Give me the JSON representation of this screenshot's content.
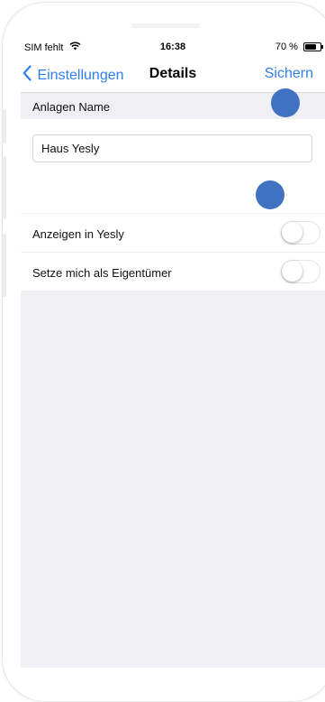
{
  "status_bar": {
    "carrier": "SIM fehlt",
    "time": "16:38",
    "battery": "70 %",
    "wifi_icon": "wifi-icon",
    "battery_icon": "battery-icon"
  },
  "nav": {
    "back_label": "Einstellungen",
    "title": "Details",
    "save_label": "Sichern",
    "back_icon": "chevron-left-icon"
  },
  "section": {
    "header": "Anlagen Name"
  },
  "name_field": {
    "value": "Haus Yesly"
  },
  "rows": [
    {
      "label": "Anzeigen in Yesly",
      "on": false
    },
    {
      "label": "Setze mich als Eigentümer",
      "on": false
    }
  ],
  "colors": {
    "accent": "#2f80ed",
    "touch_indicator": "#3f72c0",
    "background": "#efeff4"
  }
}
